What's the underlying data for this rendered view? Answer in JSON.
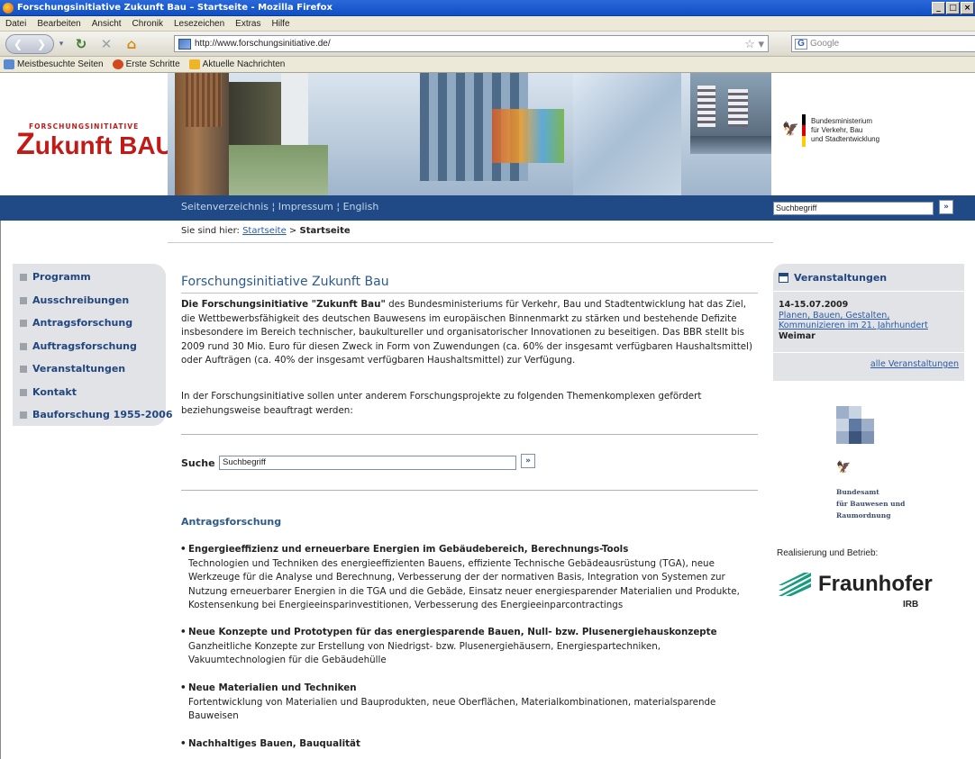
{
  "window": {
    "title": "Forschungsinitiative Zukunft Bau – Startseite - Mozilla Firefox",
    "buttons": [
      "_",
      "□",
      "×"
    ]
  },
  "menu": [
    "Datei",
    "Bearbeiten",
    "Ansicht",
    "Chronik",
    "Lesezeichen",
    "Extras",
    "Hilfe"
  ],
  "navbar": {
    "url": "http://www.forschungsinitiative.de/",
    "search_placeholder": "Google"
  },
  "bookmarks": [
    "Meistbesuchte Seiten",
    "Erste Schritte",
    "Aktuelle Nachrichten"
  ],
  "site": {
    "logo_small": "FORSCHUNGSINITIATIVE",
    "logo_z": "Z",
    "logo_ukunft": "ukunft ",
    "logo_bau": "BAU",
    "ministry": [
      "Bundesministerium",
      "für Verkehr, Bau",
      "und Stadtentwicklung"
    ],
    "toplinks": "Seitenverzeichnis ¦ Impressum ¦ English",
    "search_value": "Suchbegriff",
    "search_button": "»",
    "breadcrumb_prefix": "Sie sind hier:",
    "breadcrumb_link": "Startseite",
    "breadcrumb_sep": ">",
    "breadcrumb_current": "Startseite"
  },
  "leftnav": [
    "Programm",
    "Ausschreibungen",
    "Antragsforschung",
    "Auftragsforschung",
    "Veranstaltungen",
    "Kontakt",
    "Bauforschung 1955-2006"
  ],
  "main": {
    "title": "Forschungsinitiative Zukunft Bau",
    "intro_bold": "Die Forschungsinitiative \"Zukunft Bau\"",
    "intro_rest": " des Bundesministeriums für Verkehr, Bau und Stadtentwicklung hat das Ziel, die Wettbewerbsfähigkeit des deutschen Bauwesens im europäischen Binnenmarkt zu stärken und bestehende Defizite insbesondere im Bereich technischer, baukultureller und organisatorischer Innovationen zu beseitigen. Das BBR stellt bis 2009 rund 30 Mio. Euro für diesen Zweck in Form von Zuwendungen (ca. 60% der insgesamt verfügbaren Haushaltsmittel) oder Aufträgen (ca. 40% der insgesamt verfügbaren Haushaltsmittel) zur Verfügung.",
    "intro2": "In der Forschungsinitiative sollen unter anderem Forschungsprojekte zu folgenden Themenkomplexen gefördert beziehungsweise beauftragt werden:",
    "search_label": "Suche",
    "search_value": "Suchbegriff",
    "search_button": "»",
    "section_title": "Antragsforschung",
    "topics": [
      {
        "title": "Engergieeffizienz und erneuerbare Energien im Gebäudebereich, Berechnungs-Tools",
        "text": "Technologien und Techniken des energieeffizienten Bauens, effiziente Technische Gebädeausrüstung (TGA), neue Werkzeuge für die Analyse und Berechnung, Verbesserung der der normativen Basis, Integration von Systemen zur Nutzung erneuerbarer Energien in die TGA und die Gebäde, Einsatz neuer energiesparender Materialien und Produkte, Kostensenkung bei Energieeinsparinvestitionen, Verbesserung des Energieeinparcontractings"
      },
      {
        "title": "Neue Konzepte und Prototypen für das energiesparende Bauen, Null- bzw. Plusenergiehauskonzepte",
        "text": "Ganzheitliche Konzepte zur Erstellung von Niedrigst- bzw. Plusenergiehäusern, Energiespartechniken, Vakuumtechnologien für die Gebäudehülle"
      },
      {
        "title": "Neue Materialien und Techniken",
        "text": "Fortentwicklung von Materialien und Bauprodukten, neue Oberflächen, Materialkombinationen, materialsparende Bauweisen"
      },
      {
        "title": "Nachhaltiges Bauen, Bauqualität",
        "text": ""
      }
    ]
  },
  "events": {
    "title": "Veranstaltungen",
    "date": "14-15.07.2009",
    "link": "Planen, Bauen, Gestalten, Kommunizieren im 21. Jahrhundert",
    "place": "Weimar",
    "all": "alle Veranstaltungen"
  },
  "bbr": [
    "Bundesamt",
    "für Bauwesen und",
    "Raumordnung"
  ],
  "realisierung": "Realisierung und Betrieb:",
  "fraunhofer": "Fraunhofer",
  "irb": "IRB",
  "colors": {
    "accent_blue": "#204a86",
    "logo_red": "#c21b17",
    "link": "#2a5aa8"
  }
}
